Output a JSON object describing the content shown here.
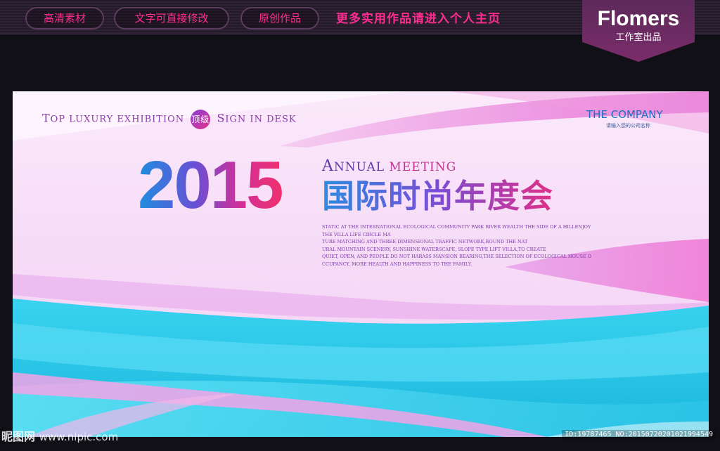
{
  "topbar": {
    "pills": [
      "高清素材",
      "文字可直接修改",
      "原创作品"
    ],
    "promo": "更多实用作品请进入个人主页",
    "brand_name": "Flomers",
    "brand_sub": "工作室出品"
  },
  "poster": {
    "tagline_parts": [
      "T",
      "OP LUXURY EXHIBITION",
      "顶级",
      "S",
      "IGN IN DESK"
    ],
    "company": "THE COMPANY",
    "company_sub": "请输入您的公司名称",
    "year": "2015",
    "annual_parts": [
      "A",
      "NNUAL",
      "MEETING"
    ],
    "title_cn": "国际时尚年度会",
    "description_lines": [
      "STATIC AT THE INTERNATIONAL ECOLOGICAL COMMUNITY PARK RIVER WEALTH THE SIDE OF A HILLENJOY",
      "THE VILLA LIFE CIRCLE MA",
      "TURE MATCHING AND THREE-DIMENSIONAL TRAFFIC NETWORK,ROUND THE NAT",
      "URAL MOUNTAIN SCENERY, SUNSHINE WATERSCAPE, SLOPE TYPE LIFT VILLA,TO CREATE",
      "QUIET, OPEN, AND PEOPLE DO NOT HARASS MANSION BEARING,THE SELECTION OF ECOLOGICAL HOUSE O",
      "CCUPANCY, MORE HEALTH AND HAPPINESS TO THE FAMILY."
    ]
  },
  "watermark": {
    "left_logo": "昵图网",
    "left_url": "www.nipic.com",
    "right_id": "ID:19787465 NO:20150720201021994549"
  },
  "colors": {
    "accent_pink": "#ff2d8f",
    "cyan": "#2ec7e8",
    "purple": "#8a3aa8"
  }
}
